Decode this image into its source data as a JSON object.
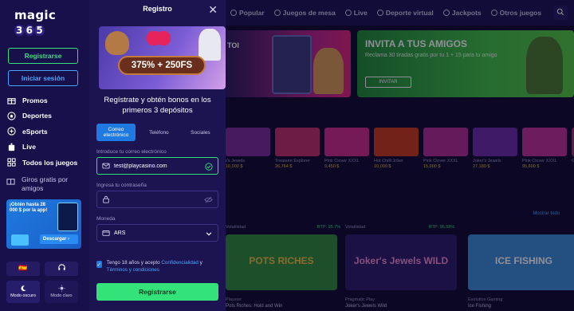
{
  "sidebar": {
    "logo": "magic 365",
    "register_label": "Registrarse",
    "login_label": "Iniciar sesión",
    "nav": [
      {
        "label": "Promos",
        "icon": "gift-icon"
      },
      {
        "label": "Deportes",
        "icon": "soccer-ball-icon"
      },
      {
        "label": "eSports",
        "icon": "gamepad-icon"
      },
      {
        "label": "Live",
        "icon": "live-icon"
      },
      {
        "label": "Todos los juegos",
        "icon": "grid-icon"
      }
    ],
    "free_spins": "Giros gratis por amigos",
    "app_card": {
      "text": "¡Obtén hasta 28 000 $ por la app!",
      "download": "Descargar"
    },
    "language_flag": "🇪🇸",
    "support_icon": "headset-icon",
    "dark_mode": "Modo oscuro",
    "light_mode": "Modo claro"
  },
  "modal": {
    "title": "Registro",
    "banner_offer": "375% + 250FS",
    "lead": "Regístrate y obtén bonos en los primeros 3 depósitos",
    "tabs": [
      "Correo electrónico",
      "Teléfono",
      "Sociales"
    ],
    "email": {
      "label": "Introduce tu correo electrónico",
      "value": "test@playcasino.com"
    },
    "password": {
      "label": "Ingresa tu contraseña",
      "value": ""
    },
    "currency": {
      "label": "Moneda",
      "value": "ARS"
    },
    "terms": {
      "prefix": "Tengo 18 años y acepto ",
      "link1": "Confidencialidad",
      "mid": " y ",
      "link2": "Términos y condiciones"
    },
    "submit": "Registrarse"
  },
  "background": {
    "topbar": [
      "Popular",
      "Juegos de mesa",
      "Live",
      "Deporte virtual",
      "Jackpots",
      "Otros juegos"
    ],
    "hero_left_text": "TOI",
    "hero_right": {
      "title": "INVITA A TUS AMIGOS",
      "subtitle": "Reclama 30 tiradas gratis por tu 1 + 15 para tu amigo",
      "button": "INVITAR"
    },
    "thumbs": [
      {
        "name": "r's Jewels",
        "value": "10,000 $",
        "color": "#7a2a9a"
      },
      {
        "name": "Treasure Explorer",
        "value": "26,764 $",
        "color": "#c0306a"
      },
      {
        "name": "Pink Clover XXXL",
        "value": "9,450 $",
        "color": "#d02a8a"
      },
      {
        "name": "Hot Chilli Joker",
        "value": "10,000 $",
        "color": "#c83a1a"
      },
      {
        "name": "Pink Clover XXXL",
        "value": "15,900 $",
        "color": "#b02a92"
      },
      {
        "name": "Joker's Jewels",
        "value": "27,180 $",
        "color": "#6a2aa8"
      },
      {
        "name": "Pink Clover XXXL",
        "value": "95,600 $",
        "color": "#c03098"
      },
      {
        "name": "Giro",
        "value": "",
        "color": "#a02a70"
      }
    ],
    "show_all": "Mostrar todo",
    "cards": [
      {
        "vol": "Volatilidad",
        "rtp": "RTP: 95.7%",
        "title": "POTS RICHES",
        "name": "Pots Riches: Hold and Win",
        "provider": "Playson",
        "color": "#2d8a3a"
      },
      {
        "vol": "Volatilidad",
        "rtp": "RTP: 96.58%",
        "title": "Joker's Jewels WILD",
        "name": "Joker's Jewels Wild",
        "provider": "Pragmatic Play",
        "color": "#2a1a6a"
      },
      {
        "vol": "",
        "rtp": "",
        "title": "ICE FISHING",
        "name": "Ice Fishing",
        "provider": "Evolution Gaming",
        "color": "#3a8ad8"
      }
    ]
  }
}
